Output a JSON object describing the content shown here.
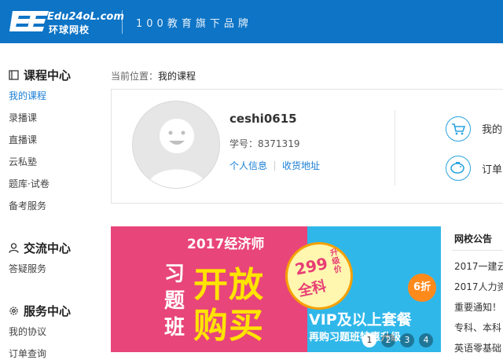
{
  "header": {
    "logo_line1": "Edu24oL.com",
    "logo_line2": "环球网校",
    "tagline": "100教育旗下品牌",
    "bg_color": "#0d74c6"
  },
  "sidebar": {
    "groups": [
      {
        "title": "课程中心",
        "icon": "course-book-icon",
        "items": [
          "我的课程",
          "录播课",
          "直播课",
          "云私塾",
          "题库·试卷",
          "备考服务"
        ]
      },
      {
        "title": "交流中心",
        "icon": "user-icon",
        "items": [
          "答疑服务"
        ]
      },
      {
        "title": "服务中心",
        "icon": "gear-icon",
        "items": [
          "我的协议",
          "订单查询"
        ]
      }
    ],
    "active_item": "我的课程",
    "active_color": "#1b7fd6"
  },
  "breadcrumb": {
    "prefix": "当前位置：",
    "current": "我的课程"
  },
  "profile": {
    "username": "ceshi0615",
    "student_no_label": "学号：",
    "student_no": "8371319",
    "link_info": "个人信息",
    "link_address": "收货地址",
    "quick_links": [
      {
        "label": "我的",
        "icon": "cart-icon"
      },
      {
        "label": "订单",
        "icon": "piggy-bank-icon"
      }
    ]
  },
  "banner": {
    "title": "2017经济师",
    "big_line1": "开放",
    "big_line2": "购买",
    "side_char1": "习",
    "side_char2": "题",
    "side_char3": "班",
    "badge_price": "299",
    "badge_subject": "全科",
    "badge_note": "升级价",
    "discount": "6折",
    "vip_line": "VIP及以上套餐",
    "sub_line": "再购习题班特惠升级",
    "slides": [
      "1",
      "2",
      "3",
      "4"
    ],
    "active_slide": "1"
  },
  "notices": {
    "title": "网校公告",
    "items": [
      "2017一建云",
      "2017人力资",
      "重要通知！",
      "专科、本科",
      "英语零基础"
    ]
  }
}
